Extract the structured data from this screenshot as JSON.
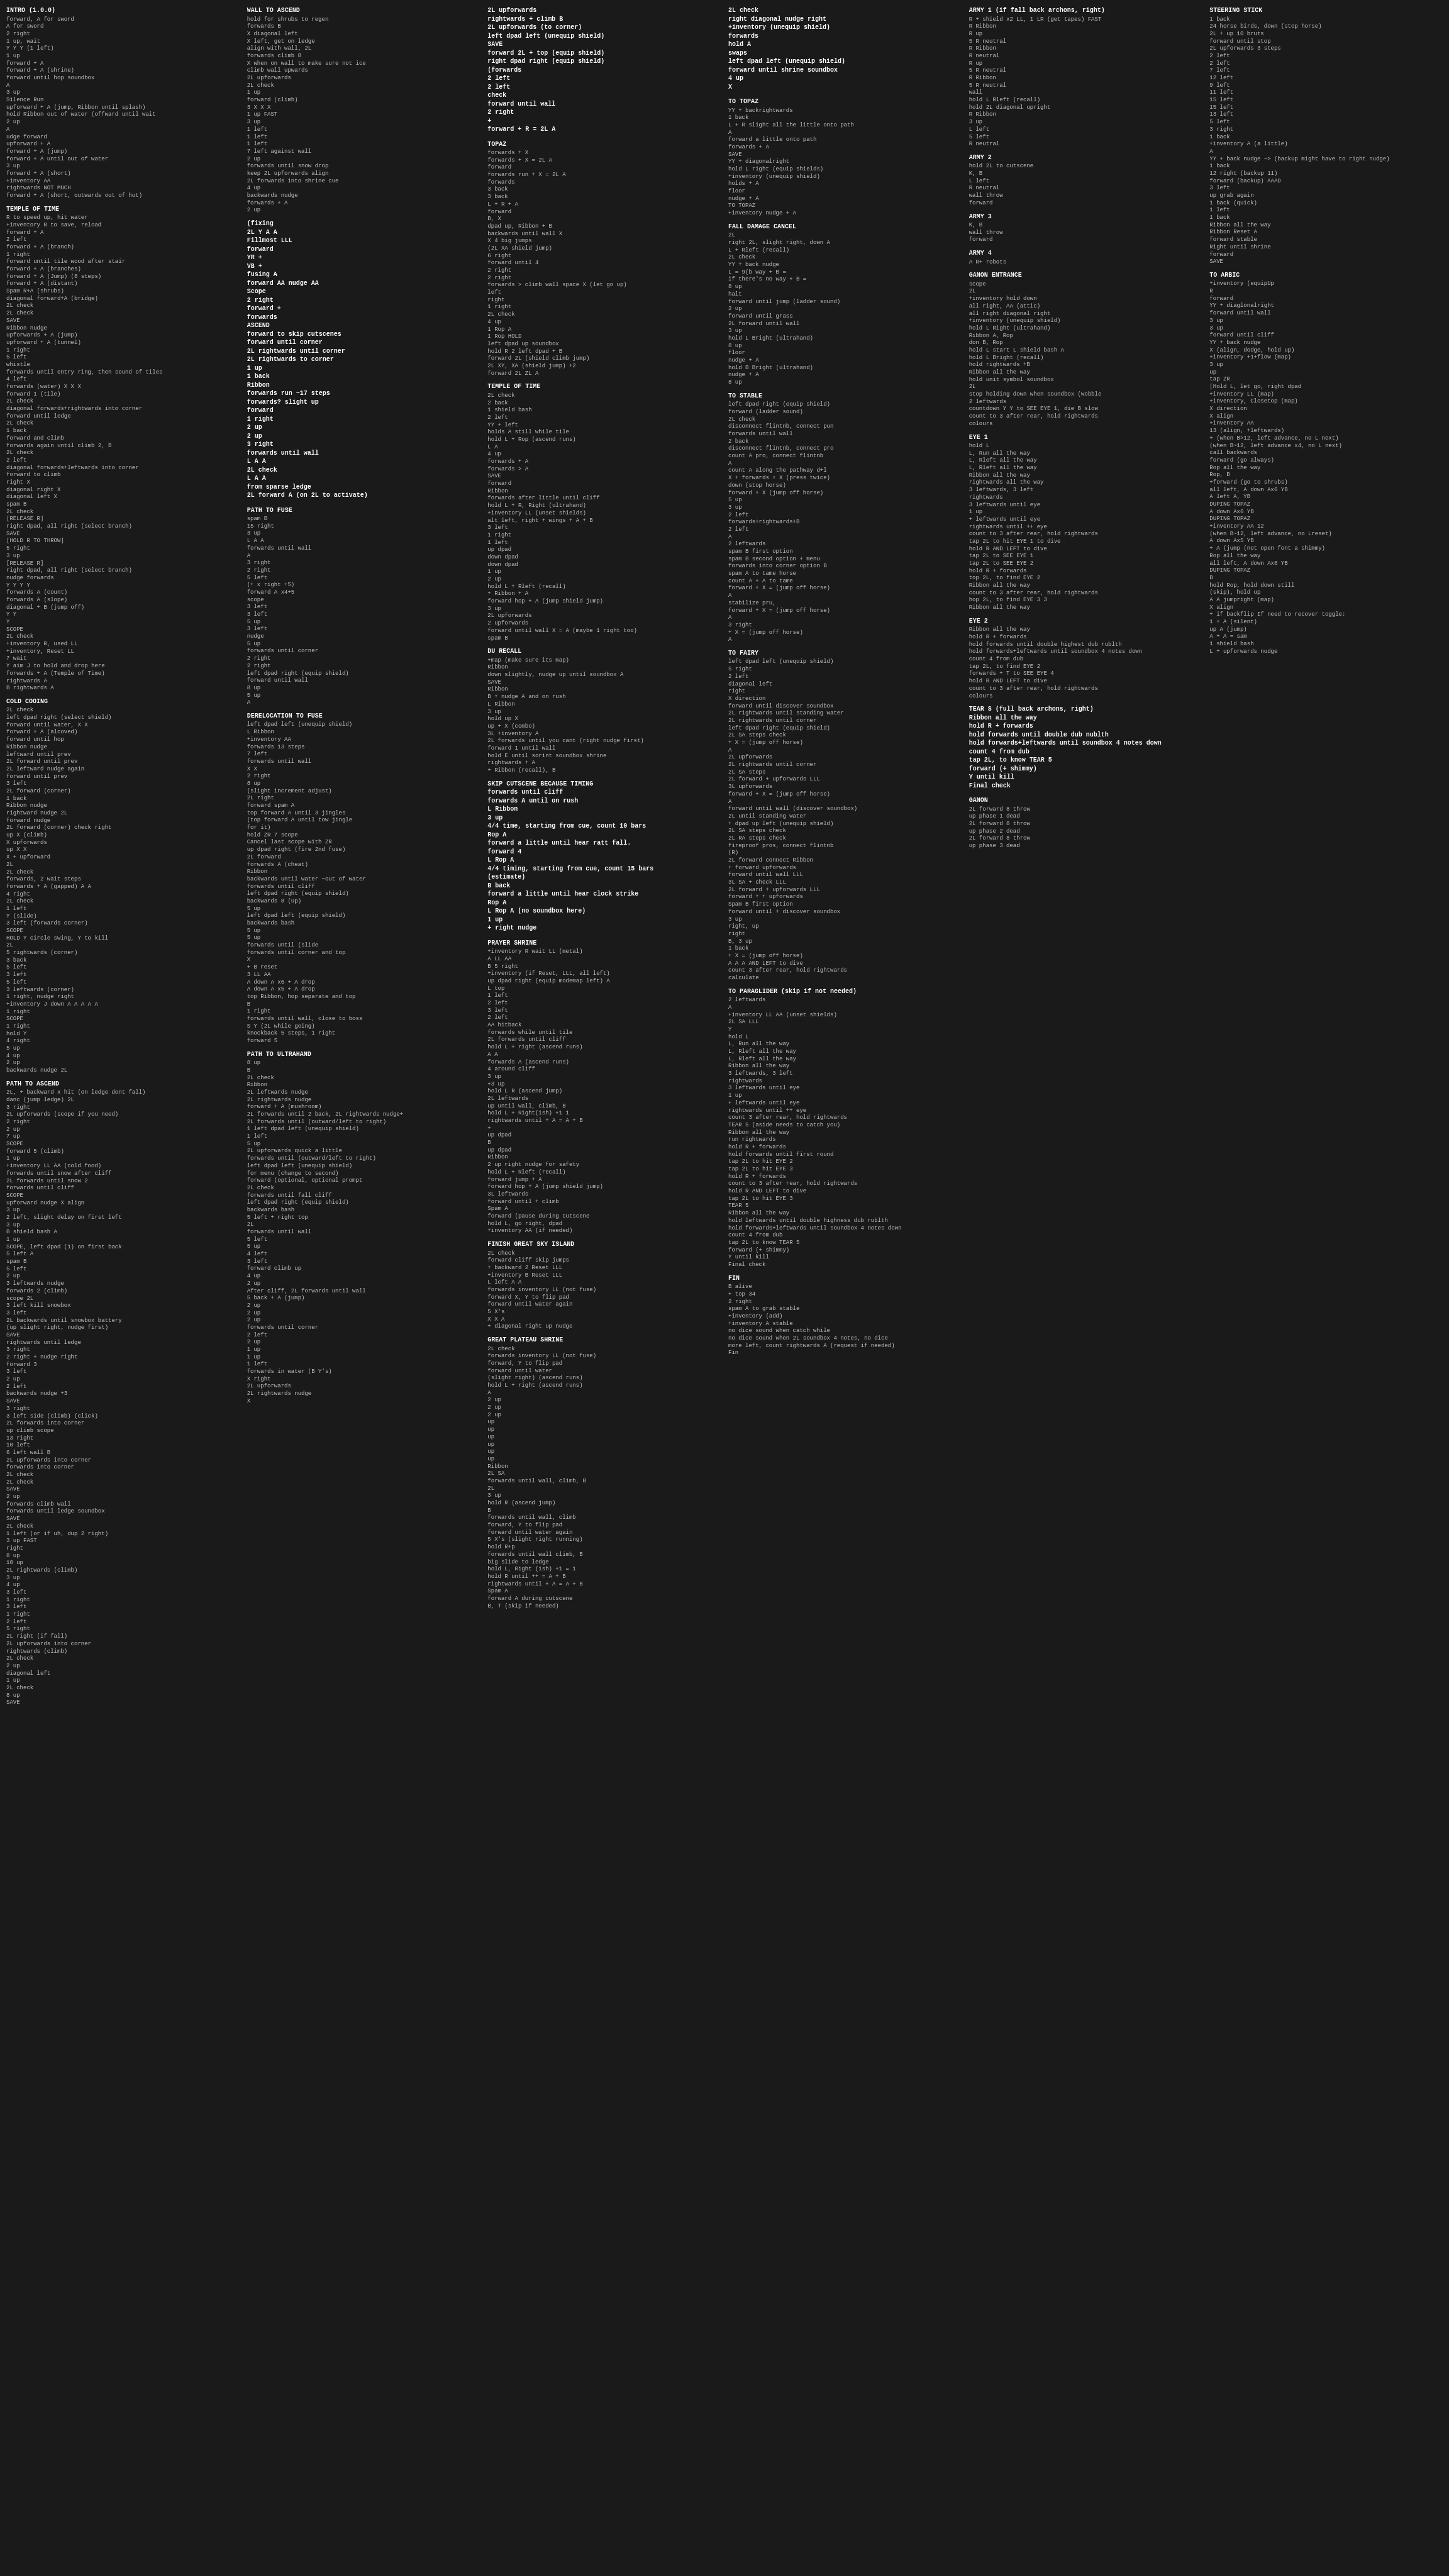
{
  "columns": [
    {
      "id": "col1",
      "sections": [
        {
          "title": "INTRO (1.0.0)",
          "content": "forward, A for sword\nA for sword\n2 right\n1 up, wait\nY Y Y (1 left)\n1 up\nforward + A\nforward + A (shrine)\nforward until hop soundbox\nA\n3 up\nSilence Run\nupforward + A (jump, Ribbon until splash)\nhold Ribbon out of water (offward until wait\n2 up\nA\nudge forward\nupforward + A\nforward + A (jump)\nforward + A until out of water\n3 up\nforward + A (short)\n+inventory AA\nrightwards NOT MUCH\nforward + A (short, outwards out of hut)"
        },
        {
          "title": "TEMPLE OF TIME",
          "content": "R to speed up, hit water\n+inventory R to save, reload\nforward + A\n2 left\nforward + A (branch)\n1 right\nforward until tile wood after stair\nforward + A (branches)\nforward + A (Jump) (8 steps)\nforward + A (distant)\nSpam R+A (shrubs)\ndiagonal forward+A (bridge)\n2L check\n2L check\nSAVE\nRibbon nudge\nupforwards + A (jump)\nupforward + A (tunnel)\n1 right\n5 left\nwhistle\nforwards until entry ring, then sound of tiles\n4 left\nforwards (water) X X X\nforward 1 (tile)\n2L check\ndiagonal forwards+rightwards into corner\nforward until ledge\n2L check\n1 back\nforward and climb\nforwards again until climb 2, B\n2L check\n2 left\ndiagonal forwards+leftwards into corner\nforward to climb\nright X\ndiagonal right X\ndiagonal left X\nspam B\n2L check\n[RELEASE R]\nright dpad, all right (select branch)\nSAVE\n[HOLD R TO THROW]\n5 right\n3 up\n[RELEASE R]\nright dpad, all right (select branch)\nnudge forwards\nY Y Y Y\nforwards A (count)\nforwards A (slope)\ndiagonal + B (jump off)\nY Y\nY\nSCOPE\n2L check\n+inventory R, used LL\n+inventory, Reset LL\n7 wait\nY aim J to hold and drop here\nforwards + A (Temple of Time)\nrightwards A\nB rightwards A"
        },
        {
          "title": "COLD COOING",
          "content": "2L check\nleft dpad right (select shield)\nforward until water, X X\nforward + A (alcoved)\nforward until hop\nRibbon nudge\nleftward until prev\n2L forward until prev\n2L leftward nudge again\nforward until prev\n3 left\n2L forward (corner)\n1 back\nRibbon nudge\nrightward nudge 2L\nforward nudge\n2L forward (corner) check right\nup X (climb)\nX upforwards\nup X X\nX + upforward\n2L\n2L check\nforwards, 2 wait steps\nforwards + A (gapped) A A\n4 right\n2L check\n1 left\nY (slide)\n3 left (forwards corner)\nSCOPE\nHOLD Y circle swing, Y to kill\n2L\n5 rightwards (corner)\n3 back\n5 left\n3 left\n5 left\n3 leftwards (corner)\n1 right, nudge right\n+inventory J down A A A A A\n1 right\nSCOPE\n1 right\nhold Y\n4 right\n5 up\n4 up\n2 up\nbackwards nudge 2L"
        },
        {
          "title": "PATH TO ASCEND",
          "content": "2L, + backward x hit (on ledge dont fall)\ndanc (jump ledge) 2L\n3 right\n2L upforwards (scope if you need)\n2 right\n2 up\n7 up\nSCOPE\nforward 5 (climb)\n1 up\n+inventory LL AA (cold food)\nforwards until snow after cliff\n2L forwards until snow 2\nforwards until cliff\nSCOPE\nupforward nudge X align\n3 up\n2 left, slight delay on first left\n3 up\nB shield bash A\n1 up\nSCOPE, left dpad (1) on first back\n5 left A\nspam B\n5 left\n2 up\n3 leftwards nudge\nforwards 2 (climb)\nscope 2L\n3 left kill snowbox\n3 left\n2L backwards until snowbox battery\n(up slight right, nudge first)\nSAVE\nrightwards until ledge\n3 right\n2 right + nudge right\nforward 3\n3 left\n2 up\n2 left\nbackwards nudge +3\nSAVE\n3 right\n3 left side (climb) (click)\n2L forwards into corner\nup climb scope\n13 right\n10 left\n6 left wall B\n2L upforwards into corner\nforwards into corner\n2L check\n2L check\nSAVE\n2 up\nforwards climb wall\nforwards until ledge soundbox\nSAVE\n2L check\n1 left (or if uh, dup 2 right)\n3 up FAST\nright\n8 up\n10 up\n2L rightwards (climb)\n3 up\n4 up\n3 left\n1 right\n3 left\n1 right\n2 left\n5 right\n2L right (if fall)\n2L upforwards into corner\nrightwards (climb)\n2L check\n2 up\ndiagonal left\n1 up\n2L check\n8 up\nSAVE"
        }
      ]
    },
    {
      "id": "col2",
      "sections": [
        {
          "title": "WALL TO ASCEND",
          "content": "hold for shrubs to regen\nforwards B\nX diagonal left\nX left, get on ledge\nalign with wall, 2L\nforwards climb B\nX when on wall to make sure not ice\nclimb wall upwards\n2L upforwards\n2L check\n1 up\nforward (climb)\n3 X X X\n1 up FAST\n3 up\n1 left\n1 left\n1 left\n7 left against wall\n2 up\nforwards until snow drop\nkeep 2L upforwards align\n2L forwards into shrine cue\n4 up\nbackwards nudge\nforwards + A\n2 up"
        },
        {
          "title": "(fixing\n2L Y A A\nFillmost LLL\nforward\nYR +\nVB +\nfusing A\nforward AA nudge AA\nScope\n2 right\nforward +\nforwards\nASCEND\nforward to skip cutscenes\nforward until corner\n2L rightwards until corner\n2L rightwards to corner\n1 up\n1 back\nRibbon\nforwards run ~17 steps\nforwards? slight up\nforward\n1 right\n2 up\n2 up\n3 right\nforwards until wall\nL A A\n2L check\nL A A\nfrom sparse ledge\n2L forward A (on 2L to activate)"
        },
        {
          "title": "PATH TO FUSE",
          "content": "spam B\n15 right\n3 up\nL A A\nforwards until wall\nA\n3 right\n2 right\n5 left\n(+ x right +5)\nforward A x4+5\nscope\n3 left\n3 left\n5 up\n3 left\nnudge\n5 up\nforwards until corner\n2 right\n2 right\nleft dpad right (equip shield)\nforward until wall\n8 up\n5 up\nA"
        },
        {
          "title": "DERELOCATION TO FUSE",
          "content": "left dpad left (unequip shield)\nL Ribbon\n+inventory AA\nforwards 13 steps\n7 left\nforwards until wall\nX X\n2 right\n8 up\n(slight increment adjust)\n2L right\nforward spam A\ntop forward A until 3 jingles\n(top forward A until tow jingle\nfor it)\nhold ZR 7 scope\nCancel last scope with ZR\nup dpad right (fire 2nd fuse)\n2L forward\nforwards A (cheat)\nRibbon\nbackwards until water ~out of water\nforwards until cliff\nleft dpad right (equip shield)\nbackwards 8 (up)\n5 up\nleft dpad left (equip shield)\nbackwards bash\n5 up\n5 up\nforwards until (slide\nforwards until corner and top\nX\n+ B reset\n3 LL AA\nA down A x6 + A drop\nA down A x5 + A drop\ntop Ribbon, hop separate and top\nB\n1 right\nforwards until wall, close to boss\nS Y (2L while going)\nknockback 5 steps, 1 right\nforward 5"
        },
        {
          "title": "PATH TO ULTRAHAND",
          "content": "8 up\nB\n2L check\nRibbon\n2L leftwards nudge\n2L rightwards nudge\nforward + A (mushroom)\n2L forwards until 2 back, 2L rightwards nudge+\n2L forwards until (outward/left to right)\n1 left dpad left (unequip shield)\n1 left\n5 up\n2L upforwards quick a little\nforwards until (outward/left to right)\nleft dpad left (unequip shield)\nfor menu (change to second)\nforward (optional, optional prompt\n2L check\nforwards until fall cliff\nleft dpad right (equip shield)\nbackwards bash\n5 left + right top\n2L\nforwards until wall\n5 left\n5 up\n4 left\n3 left\nforward climb up\n4 up\n2 up\nAfter cliff, 2L forwards until wall\n5 back + A (jump)\n2 up\n2 up\n2 up\nforwards until corner\n2 left\n2 up\n1 up\n1 up\n1 left\nforwards in water (B Y's)\nX right\n2L upforwards\n2L rightwards nudge\nX"
        }
      ]
    },
    {
      "id": "col3",
      "sections": [
        {
          "title": "2L upforwards\nrightwards + climb B\n2L upforwards (to corner)\nleft dpad left (unequip shield)\nSAVE\nforward 2L + top (equip shield)\nright dpad right (equip shield)\n(forwards\n2 left\n2 left\ncheck\nforward until wall\n2 right\n+\nforward + R = 2L A"
        },
        {
          "title": "TOPAZ",
          "content": "forwards + X\nforwards + X = 2L A\nforward\nforwards run + X = 2L A\nforwards\n3 back\n3 back\nL + R + A\nforward\nB, X\ndpad up, Ribbon + B\nbackwards until wall X\nX 4 big jumps\n(2L XA shield jump)\n6 right\nforward until 4\n2 right\n2 right\nforwards > climb wall space X (let go up)\nleft\nright\n1 right\n2L check\n4 up\n1 Rop A\n1 Rop HOLD\nleft dpad up soundbox\nhold R 2 left dpad + B\nforward 2L (shield climb jump)\n2L XY, XA (shield jump) +2\nforward 2L ZL A"
        },
        {
          "title": "TEMPLE OF TIME",
          "content": "2L check\n2 back\n1 shield bash\n2 left\nYY + left\nholds A still while tile\nhold L + Rop (ascend runs)\nL A\n4 up\nforwards + A\nforwards > A\nSAVE\nforward\nRibbon\nforwards after little until cliff\nhold L + R, Right (ultrahand)\n+inventory LL (unset shields)\nalt left, right + wings + A + B\n3 left\n1 right\n1 left\nup dpad\ndown dpad\ndown dpad\n1 up\n2 up\nhold L + Rleft (recall)\n+ Ribbon + A\nforward hop + A (jump shield jump)\n3 up\n2L upforwards\n2 upforwards\nforward until wall X = A (maybe 1 right too)\nspam B"
        },
        {
          "title": "DU RECALL",
          "content": "+map (make sure its map)\nRibbon\ndown slightly, nudge up until soundbox A\nSAVE\nRibbon\nB + nudge A and on rush\nL Ribbon\n3 up\nhold up X\nup + X (combo)\n3L +inventory A\n2L forwards until you cant (right nudge first)\nforward 1 until wall\nhold E until sorint soundbox shrine\nrightwards + A\n+ Ribbon (recall), B"
        },
        {
          "title": "SKIP CUTSCENE BECAUSE TIMING\nforwards until cliff\nforwards A until on rush\nL Ribbon\n3 up\n4/4 time, starting from cue, count 10 bars\nRop A\nforward a little until hear ratt fall.\nforward 4\nL Rop A\n4/4 timing, starting from cue, count 15 bars\n(estimate)\nB back\nforward a little until hear clock strike\nRop A\nL Rop A (no soundbox here)\n1 up\n+ right nudge"
        },
        {
          "title": "PRAYER SHRINE",
          "content": "+inventory R wait LL (metal)\nA LL AA\nB 5 right\n+inventory (if Reset, LLL, all left)\nup dpad right (equip modemap left) A\nL top\n1 left\n2 left\n3 left\n2 left\nAA hitback\nforwards while until tile\n2L forwards until cliff\nhold L + right (ascend runs)\nA A\nforwards A (ascend runs)\n4 around cliff\n3 up\n+3 up\nhold L R (ascend jump)\n2L leftwards\nup until wall, climb, B\nhold L + Right(ish) +1 1\nrightwards until + A = A + B\n+\nup dpad\nB\nup dpad\nRibbon\n2 up right nudge for safety\nhold L + Rleft (recall)\nforward jump + A\nforward hop + A (jump shield jump)\n3L leftwards\nforward until + climb\nSpam A\nforward (pause during cutscene\nhold L, go right, dpad\n+inventory AA (if needed)"
        },
        {
          "title": "FINISH GREAT SKY ISLAND",
          "content": "2L check\nforward cliff skip jumps\n+ backward 2 Reset LLL\n+inventory B Reset LLL\nL left A A\nforwards inventory LL (not fuse)\nforward X, Y to flip pad\nforward until water again\n5 X's\nX X A\n+ diagonal right up nudge"
        },
        {
          "title": "GREAT PLATEAU SHRINE",
          "content": "2L check\nforwards inventory LL (not fuse)\nforward, Y to flip pad\nforward until water\n(slight right) (ascend runs)\nhold L + right (ascend runs)\nA\n2 up\n2 up\n2 up\nup\nup\nup\nup\nup\nup\nRibbon\n2L SA\nforwards until wall, climb, B\n2L\n3 up\nhold R (ascend jump)\nB\nforwards until wall, climb\nforward, Y to flip pad\nforward until water again\n5 X's (slight right running)\nhold R+p\nforwards until wall climb, B\nbig slide to ledge\nhold L, Right (ish) +1 = 1\nhold R until ++ = A + B\nrightwards until + A = A + B\nSpam A\nforward A during cutscene\nB, T (skip if needed)"
        }
      ]
    },
    {
      "id": "col4",
      "sections": [
        {
          "title": "2L check\nright diagonal nudge right\n+inventory (unequip shield)\nforwards\nhold A\nswaps\nleft dpad left (unequip shield)\nforward until shrine soundbox\n4 up\nX"
        },
        {
          "title": "TO TOPAZ",
          "content": "YY + backrightwards\n1 back\nL + R slight all the little onto path\nA\nforward a little onto path\nforwards + A\nSAVE\nYY + diagonalright\nhold L right (equip shields)\n+inventory (unequip shield)\nholds + A\nfloor\nnudge + A\nTO TOPAZ\n+inventory nudge + A"
        },
        {
          "title": "FALL DAMAGE CANCEL",
          "content": "2L\nright 2L, slight right, down A\nL + Rleft (recall)\n2L check\nYY + back nudge\nL = 9(b way + B =\nif there's no way + B =\n8 up\nhalt\nforward until jump (ladder sound)\n2 up\nforward until grass\n2L forward until wall\n3 up\nhold L Bright (ultrahand)\n8 up\nfloor\nnudge + A\nhold B Bright (ultrahand)\nnudge + A\n8 up"
        },
        {
          "title": "TO STABLE",
          "content": "left dpad right (equip shield)\nforward (ladder sound)\n2L check\ndisconnect flintnb, connect pun\nforwards until wall\n2 back\ndisconnect flintnb, connect pro\ncount A pro, connect flintnb\nA\ncount A along the pathway d+l\nX + forwards + X (press twice)\ndown (stop horse)\nforward + X (jump off horse)\n5 up\n3 up\n2 left\nforwards+rightwards+B\n2 left\nA\n2 leftwards\nspam B first option\nspam B second option + menu\nforwards into corner option B\nspam A to tame horse\ncount A + A to tame\nforward + X = (jump off horse)\nA\nstabilize pru,\nforward + X = (jump off horse)\nA\n3 right\n+ X = (jump off horse)\nA"
        },
        {
          "title": "TO FAIRY",
          "content": "left dpad left (unequip shield)\n5 right\n2 left\ndiagonal left\nright\nX direction\nforward until discover soundbox\n2L rightwards until standing water\n2L rightwards until corner\nleft dpad right (equip shield)\n2L SA steps check\n+ X = (jump off horse)\nA\n2L upforwards\n2L rightwards until corner\n2L SA steps\n2L forward + upforwards LLL\n3L upforwards\nforward + X = (jump off horse)\nA\nforward until wall (discover soundbox)\n2L until standing water\n+ dpad up left (unequip shield)\n2L SA steps check\n2L RA steps check\nfireproof pros, connect flintnb\n(R)\n2L forward connect Ribbon\n+ forward upforwards\nforward until wall LLL\n3L SA + check LLL\n2L forward + upforwards LLL\nforward + + upforwards\nSpam B first option\nforward until + discover soundbox\n3 up\nright, up\nright\nB, 3 up\n1 back\n+ X = (jump off horse)\nA A A AND LEFT to dive\ncount 3 after rear, hold rightwards\ncalculate"
        },
        {
          "title": "TO PARAGLIDER (skip if not needed)",
          "content": "2 leftwards\nA\n+inventory LL AA (unset shields)\n2L SA LLL\nY\nhold L\nL, Run all the way\nL, Rleft all the way\nL, Rleft all the way\nRibbon all the way\n3 leftwards, 3 left\nrightwards\n3 leftwards until eye\n1 up\n+ leftwards until eye\nrightwards until ++ eye\ncount 3 after rear, hold rightwards\nTEAR 5 (aside needs to catch you)\nRibbon all the way\nrun rightwards\nhold R + forwards\nhold forwards until first round\ntap 2L to hit EYE 2\ntap 2L to hit EYE 3\nhold R + forwards\ncount to 3 after rear, hold rightwards\nhold R AND LEFT to dive\ntap 2L to hit EYE 3\nTEAR 5\nRibbon all the way\nhold leftwards until double highness dub rublth\nhold forwards+leftwards until soundbox 4 notes down\ncount 4 from dub\ntap 2L to know TEAR 5\nforward (+ shimmy)\nY until kill\nFinal check"
        },
        {
          "title": "FIN",
          "content": "B alive\n+ top 34\n2 right\nspam A to grab stable\n+inventory (add)\n+inventory A stable\nno dice sound when catch while\nno dice sound when 2L soundbox 4 notes, no dice\nmore left, count rightwards A (request if needed)\nFin"
        }
      ]
    },
    {
      "id": "col5",
      "sections": [
        {
          "title": "ARMY 1 (if fall back archons, right)",
          "content": "R + shield x2 LL, 1 LR (get tapes) FAST\nR Ribbon\nR up\n5 R neutral\nR Ribbon\nR neutral\nR up\n5 R neutral\nR Ribbon\n5 R neutral\nwall\nhold L Rleft (recall)\nhold 2L diagonal upright\nR Ribbon\n3 up\nL left\n5 left\nR neutral"
        },
        {
          "title": "ARMY 2",
          "content": "hold 2L to cutscene\nK, B\nL left\nR neutral\nwall throw\nforward"
        },
        {
          "title": "ARMY 3",
          "content": "K, B\nwall throw\nforward"
        },
        {
          "title": "ARMY 4",
          "content": "A R+ robots"
        },
        {
          "title": "GANON ENTRANCE",
          "content": "scope\n2L\n+inventory hold down\nall right, AA (attic)\nall right diagonal right\n+inventory (unequip shield)\nhold L Right (ultrahand)\nRibbon A, Rop\ndon B, Rop\nhold L start L shield bash A\nhold L Bright (recall)\nhold rightwards +B\nRibbon all the way\nhold unit symbol soundbox\n2L\nstop holding down when soundbox (wobble\n2 leftwards\ncountdown Y Y to SEE EYE 1, die B slow\ncount to 3 after rear, hold rightwards\ncolours"
        },
        {
          "title": "EYE 1",
          "content": "hold L\nL, Run all the way\nL, Rleft all the way\nL, Rleft all the way\nRibbon all the way\nrightwards all the way\n3 leftwards, 3 left\nrightwards\n3 leftwards until eye\n1 up\n+ leftwards until eye\nrightwards until ++ eye\ncount to 3 after rear, hold rightwards\ntap 2L to hit EYE 1 to dive\nhold R AND LEFT to dive\ntap 2L to SEE EYE 1\ntap 2L to SEE EYE 2\nhold R + forwards\ntop 2L, to find EYE 2\nRibbon all the way\ncount to 3 after rear, hold rightwards\nhop 2L, to find EYE 3 3\nRibbon all the way"
        },
        {
          "title": "EYE 2",
          "content": "Ribbon all the way\nhold R + forwards\nhold forwards until double highest dub rublth\nhold forwards+leftwards until soundbox 4 notes down\ncount 4 from dub\ntap 2L, to find EYE 2\nforwards + T to SEE EYE 4\nhold R AND LEFT to dive\ncount to 3 after rear, hold rightwards\ncolours"
        },
        {
          "title": "TEAR S (full back archons, right)\nRibbon all the way\nhold R + forwards\nhold forwards until double dub nublth\nhold forwards+leftwards until soundbox 4 notes down\ncount 4 from dub\ntap 2L, to know TEAR 5\nforward (+ shimmy)\nY until kill\nFinal check"
        },
        {
          "title": "GANON",
          "content": "2L forward 8 throw\nup phase 1 dead\n2L forward 8 throw\nup phase 2 dead\n2L forward 8 throw\nup phase 3 dead"
        }
      ]
    },
    {
      "id": "col6",
      "sections": [
        {
          "title": "STEERING STICK",
          "content": "1 back\n24 horse birds, down (stop horse)\n2L + up 10 bruts\nforward until stop\n2L upforwards 3 steps\n2 left\n2 left\n7 left\n12 left\n9 left\n11 left\n15 left\n15 left\n13 left\n5 left\n3 right\n1 back\n+inventory A (a little)\nA\nYY + back nudge ~> (backup might have to right nudge)\n1 back\n12 right (backup 11)\nforward (backup) AAAD\n3 left\nup grab again\n1 back (quick)\n1 left\n1 back\nRibbon all the way\nRibbon Reset A\nforward stable\nRight until shrine\nforward\nSAVE"
        },
        {
          "title": "TO ARBIC",
          "content": "+inventory (equipUp\nR\nforward\nYY + diaglonalright\nforward until wall\n3 up\n3 up\nforward until cliff\nYY + back nudge\nX (align, dodge, hold up)\n+inventory +1+flow (map)\n3 up\nup\ntap ZR\n[Hold L, let go, right dpad\n+inventory LL (map)\n+inventory, Closetop (map)\nX direction\nX align\n+inventory AA\n13 (align, +leftwards)\n+ (when B>12, left advance, no L next)\n(when B~12, left advance x4, no L next)\ncall backwards\nforward (go always)\nRop all the way\nRop, B\n+forward (go to shrubs)\nall left, A down Ax6 YB\nA left A, YB\nDUPING TOPAZ\nA down Ax6 YB\nDUPING TOPAZ\n+inventory AA 12\n(when B~12, left advance, no Lreset)\nA down Ax5 YB\n+ A (jump (not open font a shimmy)\nRop all the way\nall left, A down Ax6 YB\nDUPING TOPAZ\nB\nhold Rop, hold down still\n(skip), hold up\nA A jumpright (map)\nX align\n+ if backflip If need to recover toggle:\n1 + A (silent)\nup A (jump)\nA + A = sam\n1 shield bash\nL + upforwards nudge"
        }
      ]
    }
  ]
}
